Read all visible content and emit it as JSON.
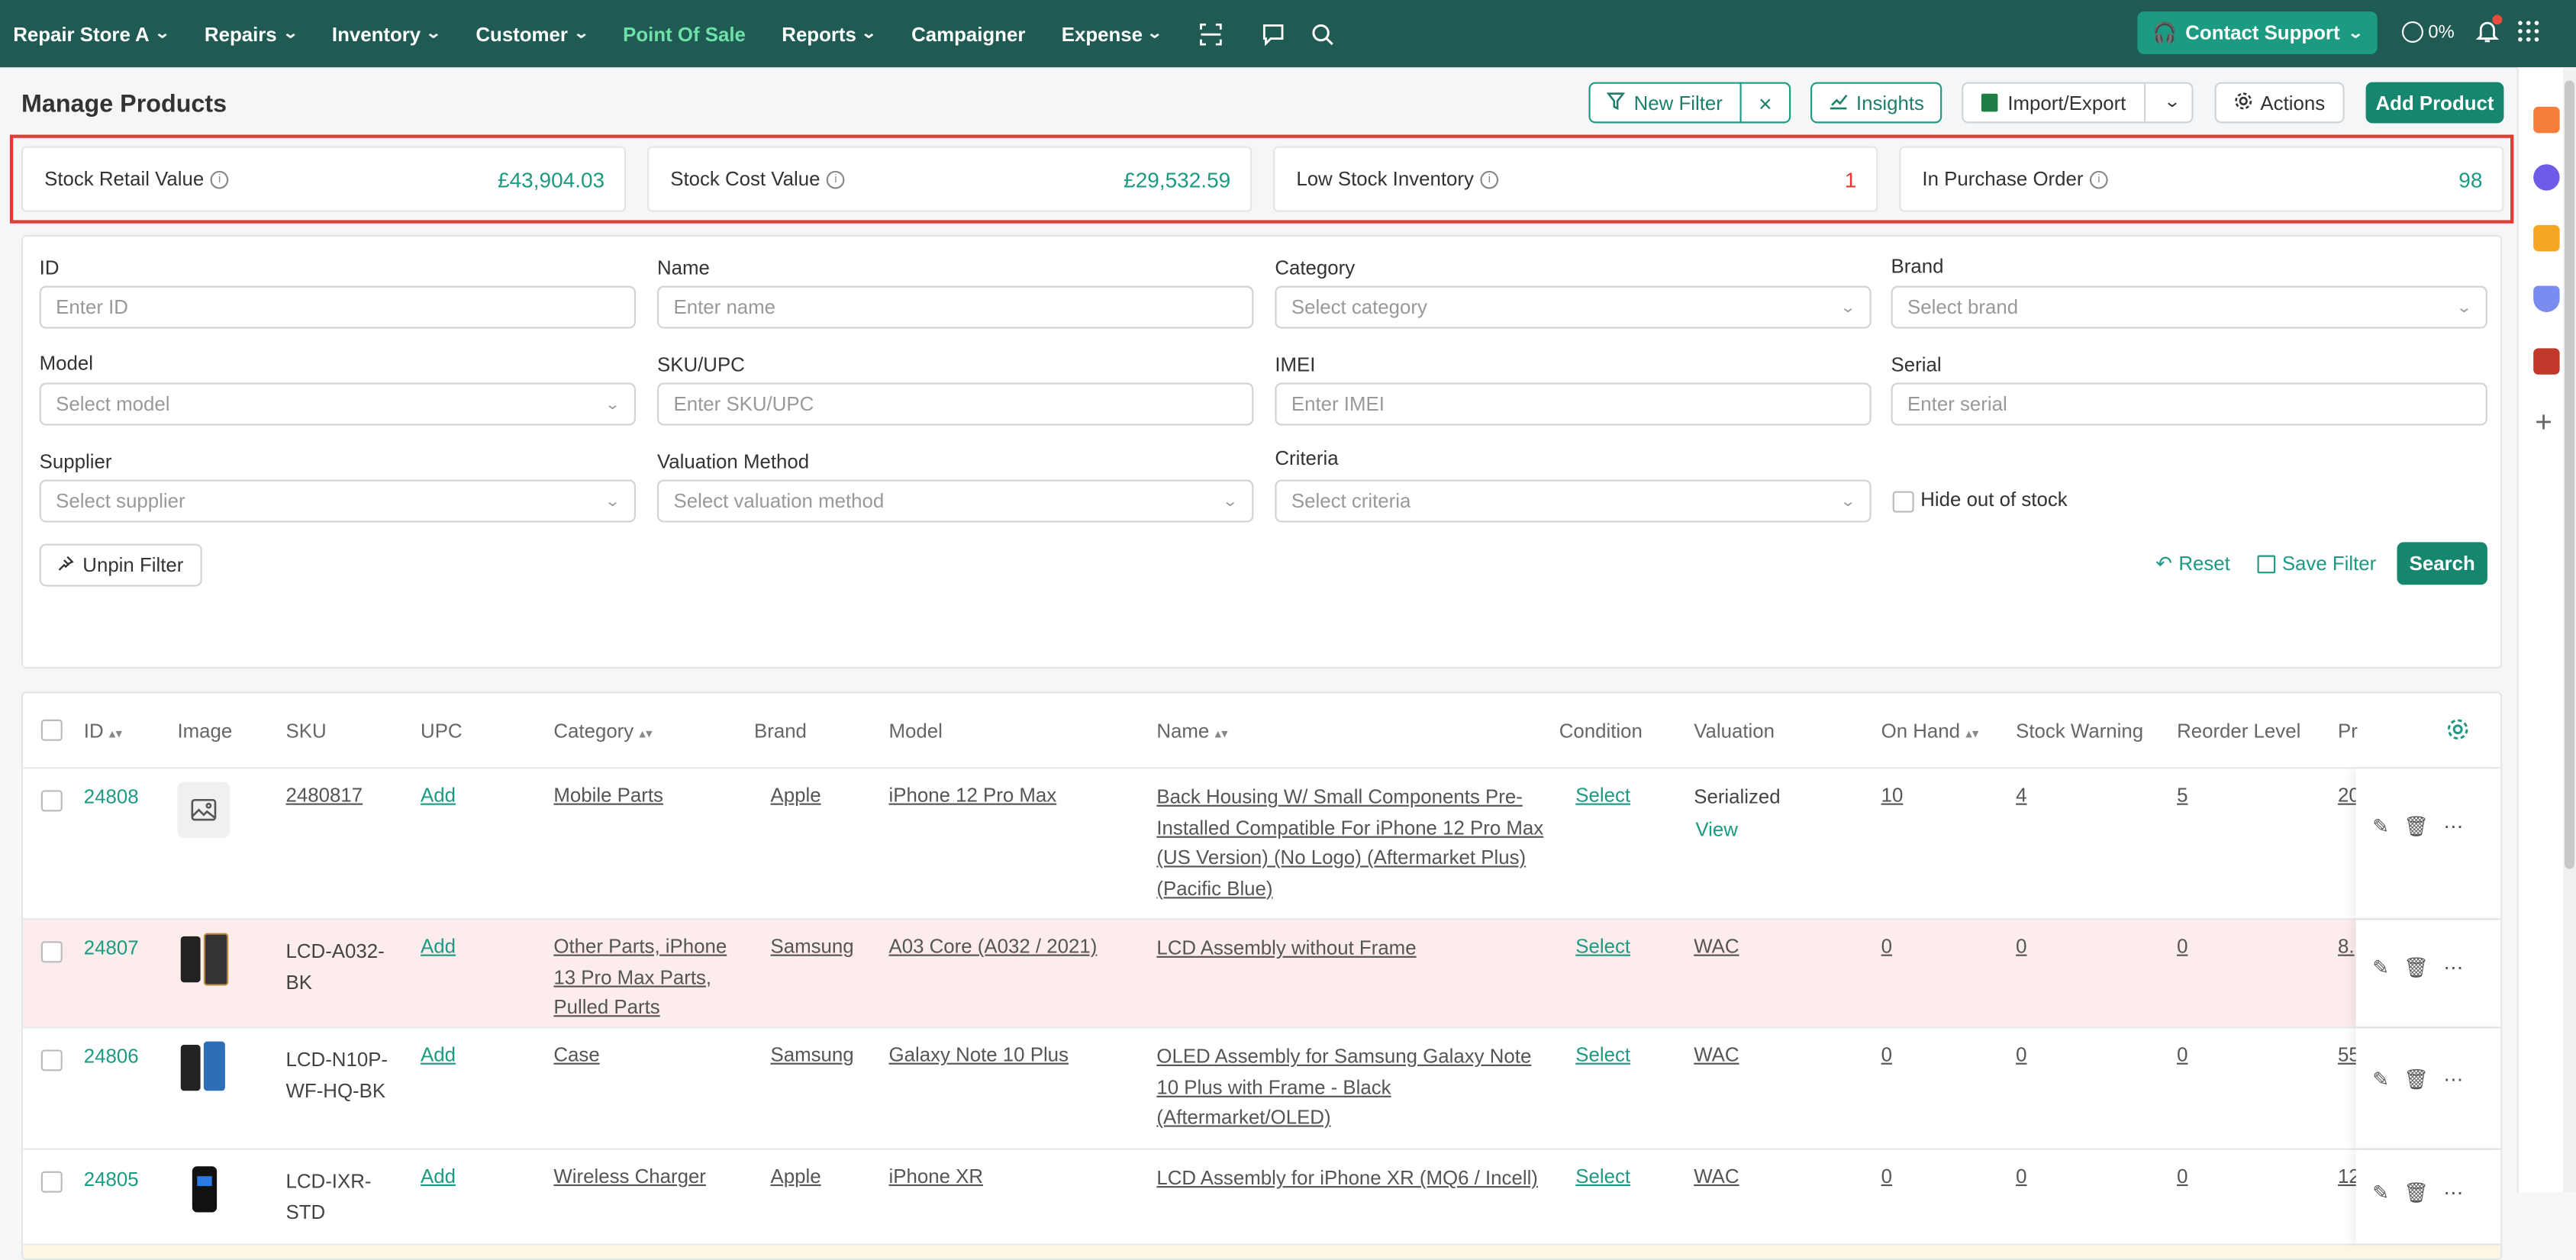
{
  "nav": {
    "store": "Repair Store A",
    "items": [
      "Repairs",
      "Inventory",
      "Customer",
      "Point Of Sale",
      "Reports",
      "Campaigner",
      "Expense"
    ],
    "active": "Point Of Sale",
    "support": "Contact Support",
    "progress": "0%"
  },
  "page": {
    "title": "Manage Products",
    "new_filter": "New Filter",
    "insights": "Insights",
    "import_export": "Import/Export",
    "actions": "Actions",
    "add_product": "Add Product"
  },
  "stats": [
    {
      "label": "Stock Retail Value",
      "value": "£43,904.03"
    },
    {
      "label": "Stock Cost Value",
      "value": "£29,532.59"
    },
    {
      "label": "Low Stock Inventory",
      "value": "1"
    },
    {
      "label": "In Purchase Order",
      "value": "98"
    }
  ],
  "filters": {
    "id": {
      "label": "ID",
      "placeholder": "Enter ID"
    },
    "name": {
      "label": "Name",
      "placeholder": "Enter name"
    },
    "category": {
      "label": "Category",
      "placeholder": "Select category"
    },
    "brand": {
      "label": "Brand",
      "placeholder": "Select brand"
    },
    "model": {
      "label": "Model",
      "placeholder": "Select model"
    },
    "sku": {
      "label": "SKU/UPC",
      "placeholder": "Enter SKU/UPC"
    },
    "imei": {
      "label": "IMEI",
      "placeholder": "Enter IMEI"
    },
    "serial": {
      "label": "Serial",
      "placeholder": "Enter serial"
    },
    "supplier": {
      "label": "Supplier",
      "placeholder": "Select supplier"
    },
    "valuation": {
      "label": "Valuation Method",
      "placeholder": "Select valuation method"
    },
    "criteria": {
      "label": "Criteria",
      "placeholder": "Select criteria"
    },
    "hide_out": "Hide out of stock",
    "unpin": "Unpin Filter",
    "reset": "Reset",
    "save": "Save Filter",
    "search": "Search"
  },
  "columns": [
    "ID",
    "Image",
    "SKU",
    "UPC",
    "Category",
    "Brand",
    "Model",
    "Name",
    "Condition",
    "Valuation",
    "On Hand",
    "Stock Warning",
    "Reorder Level",
    "Pr"
  ],
  "rows": [
    {
      "id": "24808",
      "sku": "2480817",
      "upc": "Add",
      "category": "Mobile Parts",
      "brand": "Apple",
      "model": "iPhone 12 Pro Max",
      "name": "Back Housing W/ Small Components Pre-Installed Compatible For iPhone 12 Pro Max (US Version) (No Logo) (Aftermarket Plus) (Pacific Blue)",
      "condition": "Select",
      "valuation": "Serialized",
      "valuation_link": "View",
      "on_hand": "10",
      "stock_warning": "4",
      "reorder": "5",
      "price": "20"
    },
    {
      "id": "24807",
      "sku": "LCD-A032-BK",
      "upc": "Add",
      "category": "Other Parts, iPhone 13 Pro Max Parts, Pulled Parts",
      "brand": "Samsung",
      "model": "A03 Core (A032 / 2021)",
      "name": "LCD Assembly without Frame",
      "condition": "Select",
      "valuation": "WAC",
      "on_hand": "0",
      "stock_warning": "0",
      "reorder": "0",
      "price": "8."
    },
    {
      "id": "24806",
      "sku": "LCD-N10P-WF-HQ-BK",
      "upc": "Add",
      "category": "Case",
      "brand": "Samsung",
      "model": "Galaxy Note 10 Plus",
      "name": "OLED Assembly for Samsung Galaxy Note 10 Plus with Frame - Black (Aftermarket/OLED)",
      "condition": "Select",
      "valuation": "WAC",
      "on_hand": "0",
      "stock_warning": "0",
      "reorder": "0",
      "price": "55"
    },
    {
      "id": "24805",
      "sku": "LCD-IXR-STD",
      "upc": "Add",
      "category": "Wireless Charger",
      "brand": "Apple",
      "model": "iPhone XR",
      "name": "LCD Assembly for iPhone XR (MQ6 / Incell)",
      "condition": "Select",
      "valuation": "WAC",
      "on_hand": "0",
      "stock_warning": "0",
      "reorder": "0",
      "price": "12"
    }
  ]
}
